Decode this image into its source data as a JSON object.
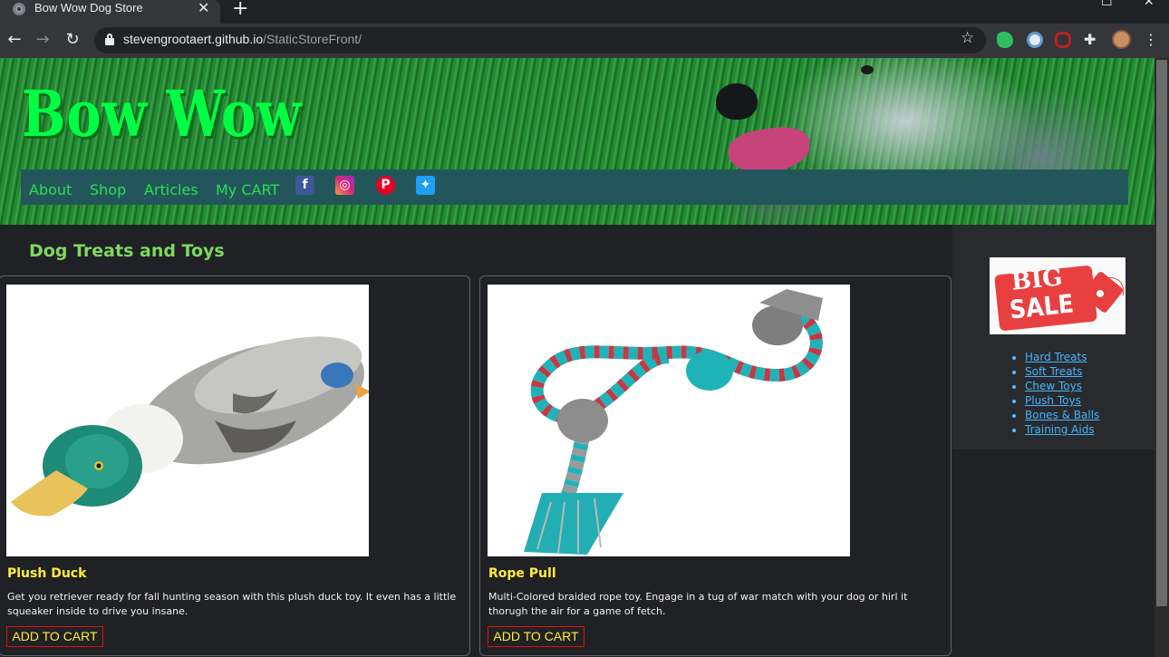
{
  "browser": {
    "tab_title": "Bow Wow Dog Store",
    "tab_close": "✕",
    "new_tab": "+",
    "url_host": "stevengrootaert.github.io",
    "url_path": "/StaticStoreFront/",
    "icons": [
      "back-icon",
      "forward-icon",
      "reload-icon",
      "lock-icon",
      "star-icon",
      "evernote-icon",
      "extension-icon",
      "extension-icon",
      "puzzle-icon",
      "profile-avatar",
      "menu-icon"
    ]
  },
  "site": {
    "brand": "Bow Wow",
    "nav": {
      "about": "About",
      "shop": "Shop",
      "articles": "Articles",
      "cart": "My CART"
    },
    "social": [
      "facebook-icon",
      "instagram-icon",
      "pinterest-icon",
      "twitter-icon"
    ],
    "colors": {
      "brand": "#00ff44",
      "nav_bg": "#23565a",
      "nav_link": "#27e052",
      "product_name": "#ffee3a",
      "button_border": "#dd1111"
    }
  },
  "main": {
    "section_title": "Dog Treats and Toys",
    "products": [
      {
        "name": "Plush Duck",
        "description": "Get you retriever ready for fall hunting season with this plush duck toy. It even has a little squeaker inside to drive you insane.",
        "button": "ADD TO CART"
      },
      {
        "name": "Rope Pull",
        "description": "Multi-Colored braided rope toy. Engage in a tug of war match with your dog or hirl it thorugh the air for a game of fetch.",
        "button": "ADD TO CART"
      }
    ]
  },
  "sidebar": {
    "sale_big": "BIG",
    "sale_word": "SALE",
    "categories": [
      "Hard Treats",
      "Soft Treats",
      "Chew Toys",
      "Plush Toys",
      "Bones & Balls",
      "Training Aids"
    ]
  }
}
